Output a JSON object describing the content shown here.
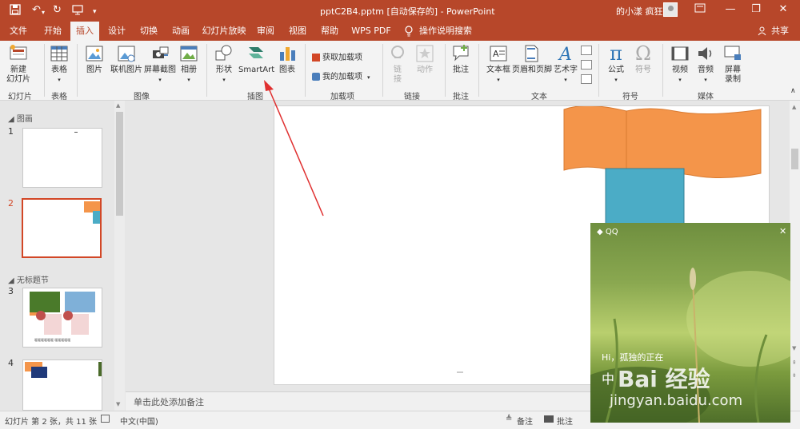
{
  "titlebar": {
    "title": "pptC2B4.pptm [自动保存的] - PowerPoint",
    "user": "的小漾 疯狂",
    "min": "—",
    "restore": "❐",
    "close": "✕"
  },
  "tabs": [
    {
      "label": "文件"
    },
    {
      "label": "开始"
    },
    {
      "label": "插入"
    },
    {
      "label": "设计"
    },
    {
      "label": "切换"
    },
    {
      "label": "动画"
    },
    {
      "label": "幻灯片放映"
    },
    {
      "label": "审阅"
    },
    {
      "label": "视图"
    },
    {
      "label": "帮助"
    },
    {
      "label": "WPS PDF"
    },
    {
      "label": "操作说明搜索"
    }
  ],
  "share": "共享",
  "ribbon": {
    "new_slide": "新建\n幻灯片",
    "table": "表格",
    "picture": "图片",
    "online_picture": "联机图片",
    "screenshot": "屏幕截图",
    "album": "相册",
    "shapes": "形状",
    "smartart": "SmartArt",
    "chart": "图表",
    "get_addins": "获取加载项",
    "my_addins": "我的加载项",
    "link": "链\n接",
    "action": "动作",
    "comment": "批注",
    "textbox": "文本框",
    "header_footer": "页眉和页脚",
    "wordart": "艺术字",
    "equation": "公式",
    "symbol": "符号",
    "video": "视频",
    "audio": "音频",
    "screen_record": "屏幕\n录制",
    "groups": {
      "slides": "幻灯片",
      "tables": "表格",
      "images": "图像",
      "illustrations": "插图",
      "addins": "加载项",
      "links": "链接",
      "comments": "批注",
      "text": "文本",
      "symbols": "符号",
      "media": "媒体"
    }
  },
  "slides_pane": {
    "section1": "图画",
    "section2": "无标题节",
    "numbers": [
      "1",
      "2",
      "3",
      "4"
    ],
    "thumb3_caption": "暖暖暖暖暖暖 暖暖暖暖暖"
  },
  "notes_placeholder": "单击此处添加备注",
  "status": {
    "slide_info": "幻灯片 第 2 张，共 11 张",
    "language": "中文(中国)",
    "notes": "备注",
    "comments": "批注"
  },
  "qq": {
    "brand": "QQ",
    "close": "✕",
    "greeting": "Hi，孤独的正在",
    "line2": "中",
    "watermark_logo": "Bai 经验",
    "watermark_url": "jingyan.baidu.com"
  },
  "colors": {
    "accent": "#b7472a",
    "orange_flag": "#f4954a",
    "blue_block": "#4bacc6"
  }
}
